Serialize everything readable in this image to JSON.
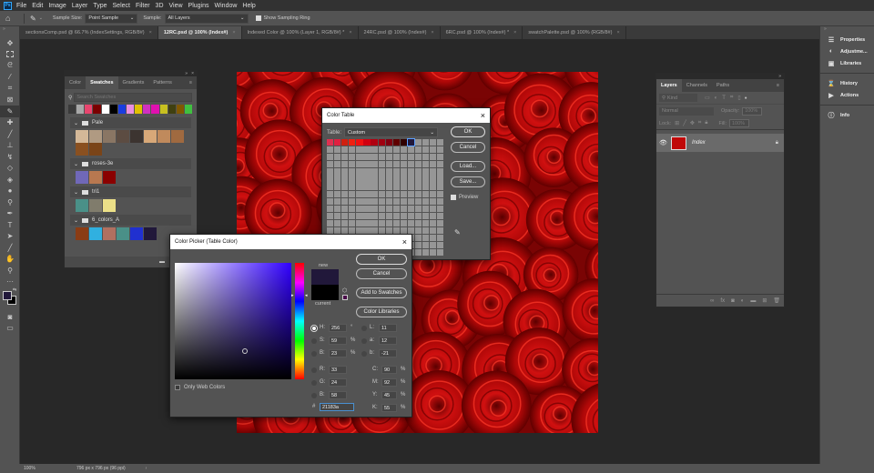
{
  "app": {
    "logo": "Ps"
  },
  "menu": [
    "File",
    "Edit",
    "Image",
    "Layer",
    "Type",
    "Select",
    "Filter",
    "3D",
    "View",
    "Plugins",
    "Window",
    "Help"
  ],
  "options_bar": {
    "sample_size_label": "Sample Size:",
    "sample_size_value": "Point Sample",
    "sample_label": "Sample:",
    "sample_value": "All Layers",
    "show_ring_label": "Show Sampling Ring",
    "show_ring_checked": true
  },
  "doc_tabs": [
    {
      "label": "sectionsComp.psd @ 66.7% (IndexSettings, RGB/8#)",
      "active": false
    },
    {
      "label": "12RC.psd @ 100% (Index#)",
      "active": true
    },
    {
      "label": "Indexed Color @ 100% (Layer 1, RGB/8#) *",
      "active": false
    },
    {
      "label": "24RC.psd @ 100% (Index#)",
      "active": false
    },
    {
      "label": "6RC.psd @ 100% (Index#) *",
      "active": false
    },
    {
      "label": "swatchPalette.psd @ 100% (RGB/8#)",
      "active": false
    }
  ],
  "status_bar": {
    "zoom": "100%",
    "doc_size": "796 px x 796 px (96 ppi)"
  },
  "swatches_panel": {
    "tabs": [
      "Color",
      "Swatches",
      "Gradients",
      "Patterns"
    ],
    "active_tab": "Swatches",
    "search_placeholder": "Search Swatches",
    "recent": [
      "#3a3a3a",
      "#a8a8a8",
      "#e8456e",
      "#7a0000",
      "#ffffff",
      "#000000",
      "#1a3de0",
      "#ea8fe0",
      "#e0c000",
      "#d030c0",
      "#e010b0",
      "#c8c020",
      "#404010",
      "#805800",
      "#40c040"
    ],
    "groups": [
      {
        "name": "Pale",
        "colors": [
          "#d4b898",
          "#b09a82",
          "#8a7664",
          "#5c4c42",
          "#3c3430",
          "#d8a878",
          "#c08a5c",
          "#a06a40",
          "#8a5020",
          "#7a4418"
        ]
      },
      {
        "name": "roses-3e",
        "colors": [
          "#7068b8",
          "#b87850",
          "#8a0000"
        ]
      },
      {
        "name": "tri1",
        "colors": [
          "#4a9088",
          "#807c6c",
          "#ece088"
        ]
      },
      {
        "name": "6_colors_A",
        "colors": [
          "#8a3c14",
          "#30b0e0",
          "#b07060",
          "#4a9088",
          "#2030d0",
          "#21183a"
        ]
      }
    ]
  },
  "color_table_dialog": {
    "title": "Color Table",
    "table_label": "Table:",
    "table_value": "Custom",
    "colors": [
      "#e03050",
      "#e02040",
      "#d02010",
      "#f02010",
      "#f01010",
      "#d00010",
      "#b00010",
      "#a00010",
      "#800010",
      "#600000",
      "#300000",
      "#21183a"
    ],
    "empty_color": "#969696",
    "ok": "OK",
    "cancel": "Cancel",
    "load": "Load...",
    "save": "Save...",
    "preview_label": "Preview",
    "preview_checked": true
  },
  "color_picker_dialog": {
    "title": "Color Picker (Table Color)",
    "ok": "OK",
    "cancel": "Cancel",
    "add_to_swatches": "Add to Swatches",
    "color_libraries": "Color Libraries",
    "new_label": "new",
    "current_label": "current",
    "new_color": "#21183a",
    "current_color": "#000000",
    "hue_color": "#3000ff",
    "only_web_colors": "Only Web Colors",
    "fields": {
      "H": {
        "value": "256",
        "unit": "°"
      },
      "S": {
        "value": "59",
        "unit": "%"
      },
      "B": {
        "value": "23",
        "unit": "%"
      },
      "R": {
        "value": "33"
      },
      "G": {
        "value": "24"
      },
      "B2": {
        "value": "58"
      },
      "L": {
        "value": "11"
      },
      "a": {
        "value": "12"
      },
      "b": {
        "value": "-21"
      },
      "C": {
        "value": "90",
        "unit": "%"
      },
      "M": {
        "value": "92",
        "unit": "%"
      },
      "Y": {
        "value": "45",
        "unit": "%"
      },
      "K": {
        "value": "55",
        "unit": "%"
      }
    },
    "hex_label": "#",
    "hex_value": "21183a"
  },
  "layers_panel": {
    "tabs": [
      "Layers",
      "Channels",
      "Paths"
    ],
    "active_tab": "Layers",
    "filter_placeholder": "Kind",
    "blend_mode": "Normal",
    "opacity_label": "Opacity:",
    "opacity_value": "100%",
    "lock_label": "Lock:",
    "fill_label": "Fill:",
    "fill_value": "100%",
    "layers": [
      {
        "name": "Index",
        "visible": true,
        "locked": true
      }
    ]
  },
  "right_dock": [
    {
      "label": "Properties",
      "icon": "properties-icon"
    },
    {
      "label": "Adjustme...",
      "icon": "adjustments-icon"
    },
    {
      "label": "Libraries",
      "icon": "libraries-icon"
    },
    {
      "label": "History",
      "icon": "history-icon"
    },
    {
      "label": "Actions",
      "icon": "actions-icon"
    },
    {
      "label": "Info",
      "icon": "info-icon"
    }
  ]
}
